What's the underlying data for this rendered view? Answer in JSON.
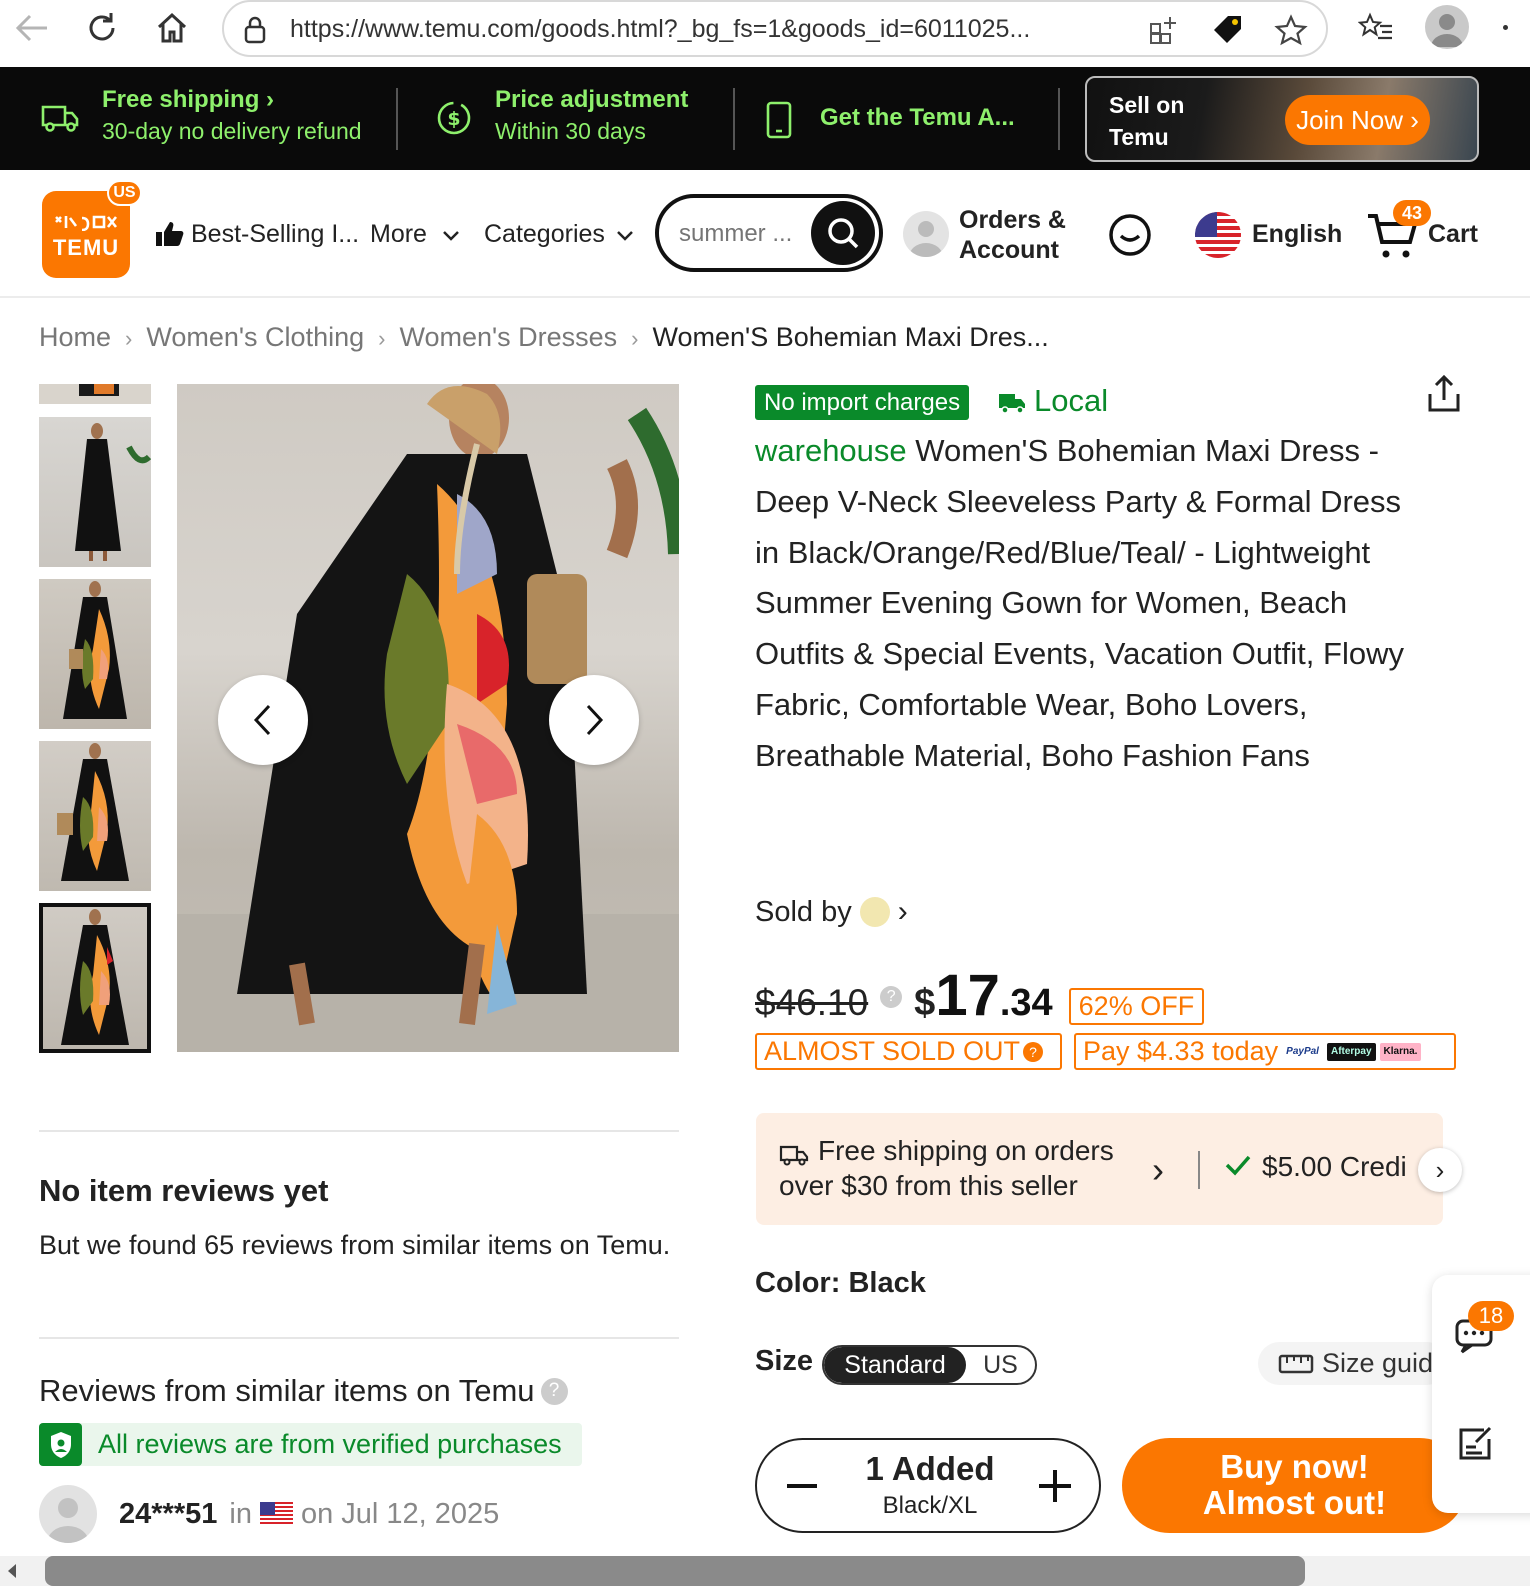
{
  "browser": {
    "url": "https://www.temu.com/goods.html?_bg_fs=1&goods_id=6011025..."
  },
  "promo": {
    "shipping_title": "Free shipping",
    "shipping_sub": "30-day no delivery refund",
    "price_title": "Price adjustment",
    "price_sub": "Within 30 days",
    "app_text": "Get the Temu A...",
    "sell_line1": "Sell on",
    "sell_line2": "Temu",
    "join_label": "Join Now",
    "accent_color": "#8ef06c"
  },
  "header": {
    "logo_text": "TEMU",
    "us_badge": "US",
    "best_selling": "Best-Selling I...",
    "more": "More",
    "categories": "Categories",
    "search_placeholder": "summer ...",
    "orders_line1": "Orders &",
    "orders_line2": "Account",
    "language": "English",
    "cart_count": "43",
    "cart_label": "Cart",
    "brand_color": "#fb7701"
  },
  "breadcrumb": {
    "items": [
      "Home",
      "Women's Clothing",
      "Women's Dresses",
      "Women'S Bohemian Maxi Dres..."
    ]
  },
  "product": {
    "tag_no_import": "No import charges",
    "tag_local": "Local",
    "tag_warehouse": "warehouse",
    "title": "Women'S Bohemian Maxi Dress - Deep V-Neck Sleeveless Party & Formal Dress in Black/Orange/Red/Blue/Teal/ - Lightweight Summer Evening Gown for Women, Beach Outfits & Special Events, Vacation Outfit, Flowy Fabric, Comfortable Wear, Boho Lovers, Breathable Material, Boho Fashion Fans",
    "sold_by": "Sold by",
    "old_price": "$46.10",
    "price_currency": "$",
    "price_main": "17",
    "price_cents": ".34",
    "off_badge": "62% OFF",
    "almost_sold_out": "ALMOST SOLD OUT",
    "pay_today": "Pay $4.33 today",
    "pay_logos": [
      "PayPal",
      "Afterpay",
      "Klarna."
    ],
    "shipping_line1": "Free shipping on orders",
    "shipping_line2": "over $30 from this seller",
    "credit": "$5.00 Credi",
    "color_label": "Color:",
    "color_value": "Black",
    "size_label": "Size",
    "size_options": [
      "Standard",
      "US"
    ],
    "size_selected": "Standard",
    "size_guide": "Size guid",
    "qty_text": "1 Added",
    "qty_variant": "Black/XL",
    "buy_line1": "Buy now!",
    "buy_line2": "Almost out!"
  },
  "side_float": {
    "badge_count": "18"
  },
  "reviews": {
    "no_reviews": "No item reviews yet",
    "found_text": "But we found 65 reviews from similar items on Temu.",
    "similar_title": "Reviews from similar items on Temu",
    "verified": "All reviews are from verified purchases",
    "reviewer_name": "24***51",
    "reviewer_in": "in",
    "reviewer_date": "on Jul 12, 2025"
  }
}
